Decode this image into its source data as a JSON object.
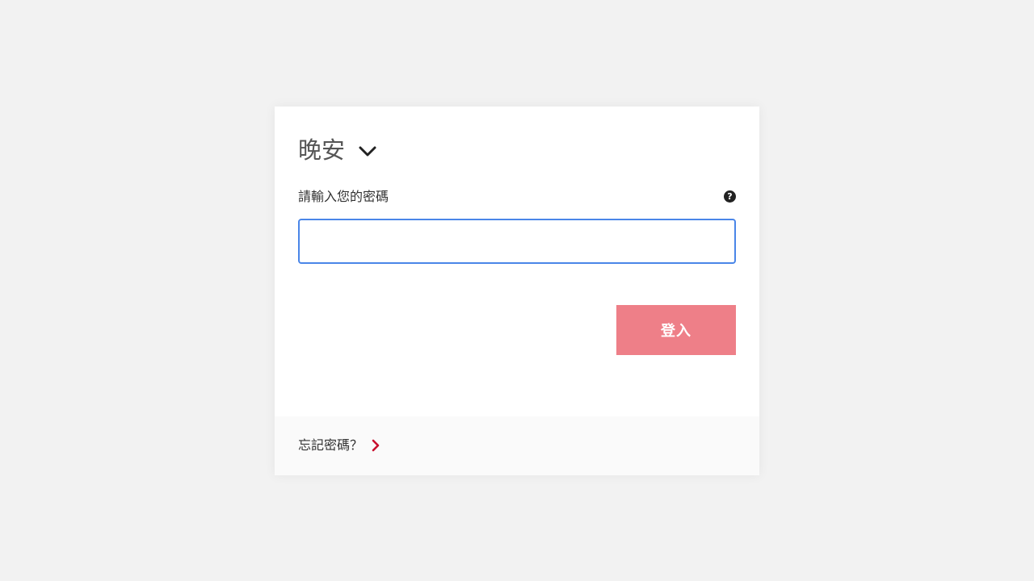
{
  "greeting": {
    "text": "晚安",
    "toggle_icon": "chevron-down-icon"
  },
  "password": {
    "label": "請輸入您的密碼",
    "value": "",
    "placeholder": "",
    "help_icon": "help-icon",
    "help_glyph": "?"
  },
  "login_button": {
    "label": "登入"
  },
  "footer": {
    "forgot_label": "忘記密碼？",
    "forgot_icon": "chevron-right-icon"
  },
  "colors": {
    "background": "#f2f2f2",
    "card": "#ffffff",
    "input_border": "#4a86e8",
    "button": "#ee7f88",
    "accent_red": "#c8102e",
    "footer": "#fafafa"
  }
}
